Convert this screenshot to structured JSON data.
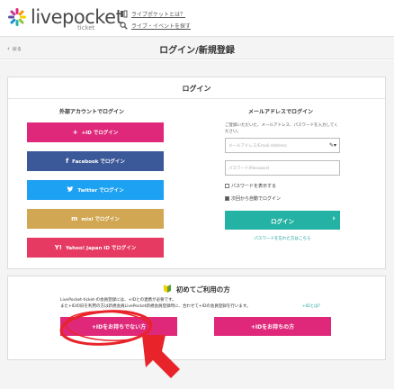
{
  "header": {
    "logo_text": "livepocket",
    "logo_sub": "ticket",
    "links": [
      "ライブポケットとは？",
      "ライブ・イベントを探す"
    ]
  },
  "titlebar": {
    "back_label": "戻る",
    "title": "ログイン/新規登録"
  },
  "login": {
    "heading": "ログイン",
    "external_heading": "外部アカウントでログイン",
    "email_heading": "メールアドレスでログイン",
    "sns_buttons": [
      {
        "label": "+ID でログイン",
        "icon": "plus-id-icon",
        "color": "#e0287a"
      },
      {
        "label": "Facebook でログイン",
        "icon": "facebook-icon",
        "color": "#3b5998"
      },
      {
        "label": "Twitter でログイン",
        "icon": "twitter-icon",
        "color": "#1da1f2"
      },
      {
        "label": "mixi でログイン",
        "icon": "mixi-icon",
        "color": "#d1a753"
      },
      {
        "label": "Yahoo! Japan ID でログイン",
        "icon": "yahoo-icon",
        "color": "#e63a63"
      }
    ],
    "description": "ご登録いただいた、メールアドレス、パスワードを入力してください。",
    "email_placeholder": "メールアドレス/Email Address",
    "password_placeholder": "パスワード/Password",
    "show_password": "パスワードを表示する",
    "auto_login": "次回から自動でログイン",
    "submit": "ログイン",
    "forgot": "パスワードを忘れた方はこちら"
  },
  "first_time": {
    "title": "初めてご利用の方",
    "line1": "LivePocket-ticket-の会員登録には、+IDとの連携が必要です。",
    "line2": "また+IDの旧を利用の方は新規会員LivePocket新規会員登録時に、合わせて+IDの会員登録を行います。",
    "link": "+IDとは？",
    "btn_no_id": "+IDをお持ちでない方",
    "btn_has_id": "+IDをお持ちの方"
  },
  "colors": {
    "pink": "#e0287a",
    "teal": "#23b2a3",
    "annotation_red": "#e8232a"
  }
}
